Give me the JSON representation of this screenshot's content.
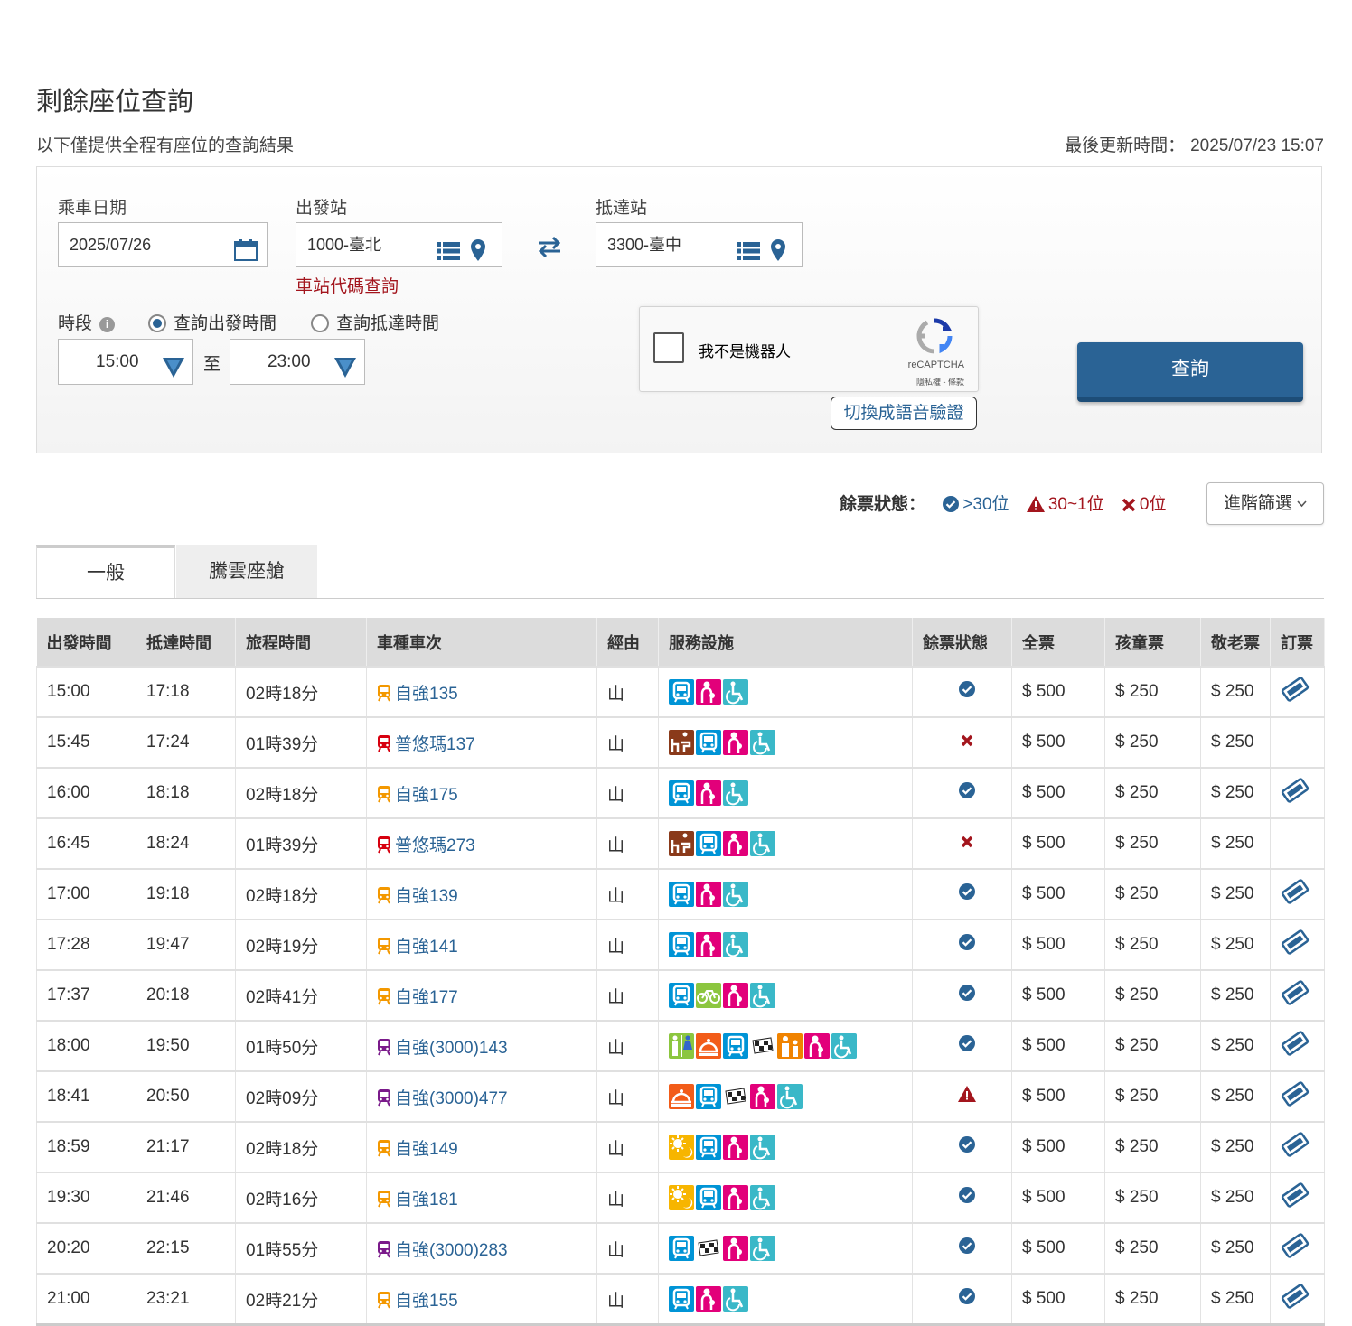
{
  "page": {
    "title": "剩餘座位查詢",
    "subtitle": "以下僅提供全程有座位的查詢結果",
    "last_updated_label": "最後更新時間：",
    "last_updated_value": "2025/07/23 15:07"
  },
  "form": {
    "date_label": "乘車日期",
    "date_value": "2025/07/26",
    "from_label": "出發站",
    "from_value": "1000-臺北",
    "to_label": "抵達站",
    "to_value": "3300-臺中",
    "station_code_link": "車站代碼查詢",
    "period_label": "時段",
    "radio_depart": "查詢出發時間",
    "radio_arrive": "查詢抵達時間",
    "selected_radio": "depart",
    "time_from": "15:00",
    "time_to_label": "至",
    "time_to": "23:00",
    "recaptcha_label": "我不是機器人",
    "recaptcha_brand": "reCAPTCHA",
    "recaptcha_terms": "隱私權 - 條款",
    "audio_button": "切換成語音驗證",
    "search_button": "查詢"
  },
  "legend": {
    "label": "餘票狀態：",
    "available": ">30位",
    "limited": "30~1位",
    "soldout": "0位",
    "advanced_filter": "進階篩選"
  },
  "tabs": [
    "一般",
    "騰雲座艙"
  ],
  "table": {
    "headers": [
      "出發時間",
      "抵達時間",
      "旅程時間",
      "車種車次",
      "經由",
      "服務設施",
      "餘票狀態",
      "全票",
      "孩童票",
      "敬老票",
      "訂票"
    ],
    "rows": [
      {
        "dep": "15:00",
        "arr": "17:18",
        "dur": "02時18分",
        "type": "tc",
        "train": "自強135",
        "via": "山",
        "fac": [
          "bus",
          "mom",
          "wheel"
        ],
        "status": "ok",
        "adult": "$ 500",
        "child": "$ 250",
        "senior": "$ 250",
        "book": true
      },
      {
        "dep": "15:45",
        "arr": "17:24",
        "dur": "01時39分",
        "type": "puyuma",
        "train": "普悠瑪137",
        "via": "山",
        "fac": [
          "meal",
          "bus",
          "mom",
          "wheel"
        ],
        "status": "none",
        "adult": "$ 500",
        "child": "$ 250",
        "senior": "$ 250",
        "book": false
      },
      {
        "dep": "16:00",
        "arr": "18:18",
        "dur": "02時18分",
        "type": "tc",
        "train": "自強175",
        "via": "山",
        "fac": [
          "bus",
          "mom",
          "wheel"
        ],
        "status": "ok",
        "adult": "$ 500",
        "child": "$ 250",
        "senior": "$ 250",
        "book": true
      },
      {
        "dep": "16:45",
        "arr": "18:24",
        "dur": "01時39分",
        "type": "puyuma",
        "train": "普悠瑪273",
        "via": "山",
        "fac": [
          "meal",
          "bus",
          "mom",
          "wheel"
        ],
        "status": "none",
        "adult": "$ 500",
        "child": "$ 250",
        "senior": "$ 250",
        "book": false
      },
      {
        "dep": "17:00",
        "arr": "19:18",
        "dur": "02時18分",
        "type": "tc",
        "train": "自強139",
        "via": "山",
        "fac": [
          "bus",
          "mom",
          "wheel"
        ],
        "status": "ok",
        "adult": "$ 500",
        "child": "$ 250",
        "senior": "$ 250",
        "book": true
      },
      {
        "dep": "17:28",
        "arr": "19:47",
        "dur": "02時19分",
        "type": "tc",
        "train": "自強141",
        "via": "山",
        "fac": [
          "bus",
          "mom",
          "wheel"
        ],
        "status": "ok",
        "adult": "$ 500",
        "child": "$ 250",
        "senior": "$ 250",
        "book": true
      },
      {
        "dep": "17:37",
        "arr": "20:18",
        "dur": "02時41分",
        "type": "tc",
        "train": "自強177",
        "via": "山",
        "fac": [
          "bus",
          "bike",
          "mom",
          "wheel"
        ],
        "status": "ok",
        "adult": "$ 500",
        "child": "$ 250",
        "senior": "$ 250",
        "book": true
      },
      {
        "dep": "18:00",
        "arr": "19:50",
        "dur": "01時50分",
        "type": "emu3000",
        "train": "自強(3000)143",
        "via": "山",
        "fac": [
          "toilet",
          "food",
          "bus",
          "flag",
          "family",
          "mom",
          "wheel"
        ],
        "status": "ok",
        "adult": "$ 500",
        "child": "$ 250",
        "senior": "$ 250",
        "book": true
      },
      {
        "dep": "18:41",
        "arr": "20:50",
        "dur": "02時09分",
        "type": "emu3000",
        "train": "自強(3000)477",
        "via": "山",
        "fac": [
          "food",
          "bus",
          "flag",
          "mom",
          "wheel"
        ],
        "status": "warn",
        "adult": "$ 500",
        "child": "$ 250",
        "senior": "$ 250",
        "book": true
      },
      {
        "dep": "18:59",
        "arr": "21:17",
        "dur": "02時18分",
        "type": "tc",
        "train": "自強149",
        "via": "山",
        "fac": [
          "day",
          "bus",
          "mom",
          "wheel"
        ],
        "status": "ok",
        "adult": "$ 500",
        "child": "$ 250",
        "senior": "$ 250",
        "book": true
      },
      {
        "dep": "19:30",
        "arr": "21:46",
        "dur": "02時16分",
        "type": "tc",
        "train": "自強181",
        "via": "山",
        "fac": [
          "day",
          "bus",
          "mom",
          "wheel"
        ],
        "status": "ok",
        "adult": "$ 500",
        "child": "$ 250",
        "senior": "$ 250",
        "book": true
      },
      {
        "dep": "20:20",
        "arr": "22:15",
        "dur": "01時55分",
        "type": "emu3000",
        "train": "自強(3000)283",
        "via": "山",
        "fac": [
          "bus",
          "flag",
          "mom",
          "wheel"
        ],
        "status": "ok",
        "adult": "$ 500",
        "child": "$ 250",
        "senior": "$ 250",
        "book": true
      },
      {
        "dep": "21:00",
        "arr": "23:21",
        "dur": "02時21分",
        "type": "tc",
        "train": "自強155",
        "via": "山",
        "fac": [
          "bus",
          "mom",
          "wheel"
        ],
        "status": "ok",
        "adult": "$ 500",
        "child": "$ 250",
        "senior": "$ 250",
        "book": true
      }
    ]
  },
  "colors": {
    "primary": "#2a6395",
    "danger": "#a3151d",
    "tc_orange": "#f39800",
    "puyuma_red": "#d7000f",
    "emu3000_purple": "#7a1a8a",
    "fac_bus": "#0094d6",
    "fac_mom": "#e2007a",
    "fac_wheel": "#3ab8c8",
    "fac_meal": "#8a3a1a",
    "fac_bike": "#8cc63f",
    "fac_food": "#f25c19",
    "fac_day": "#f7b500",
    "fac_family": "#f08300",
    "fac_toilet": "#8cc63f"
  }
}
